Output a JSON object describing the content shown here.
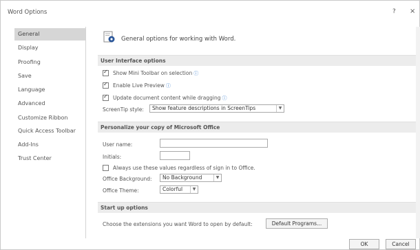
{
  "window": {
    "title": "Word Options",
    "help_label": "?",
    "close_label": "×"
  },
  "sidebar": {
    "items": [
      {
        "label": "General",
        "selected": true
      },
      {
        "label": "Display"
      },
      {
        "label": "Proofing"
      },
      {
        "label": "Save"
      },
      {
        "label": "Language"
      },
      {
        "label": "Advanced"
      },
      {
        "label": "Customize Ribbon"
      },
      {
        "label": "Quick Access Toolbar"
      },
      {
        "label": "Add-Ins"
      },
      {
        "label": "Trust Center"
      }
    ]
  },
  "main": {
    "heading": "General options for working with Word.",
    "ui_options": {
      "title": "User Interface options",
      "show_mini_toolbar": {
        "label": "Show Mini Toolbar on selection",
        "checked": true
      },
      "enable_live_preview": {
        "label": "Enable Live Preview",
        "checked": true
      },
      "update_while_dragging": {
        "label": "Update document content while dragging",
        "checked": true
      },
      "screentip_label": "ScreenTip style:",
      "screentip_value": "Show feature descriptions in ScreenTips"
    },
    "personalize": {
      "title": "Personalize your copy of Microsoft Office",
      "user_name_label": "User name:",
      "user_name_value": "",
      "initials_label": "Initials:",
      "initials_value": "",
      "always_use": {
        "label": "Always use these values regardless of sign in to Office.",
        "checked": false
      },
      "office_background_label": "Office Background:",
      "office_background_value": "No Background",
      "office_theme_label": "Office Theme:",
      "office_theme_value": "Colorful"
    },
    "startup": {
      "title": "Start up options",
      "extensions_label": "Choose the extensions you want Word to open by default:",
      "default_programs_label": "Default Programs..."
    }
  },
  "footer": {
    "ok_label": "OK",
    "cancel_label": "Cancel"
  },
  "colors": {
    "accent": "#2b579a",
    "info_icon": "#3a7fd0",
    "selected_bg": "#d6d6d6"
  }
}
